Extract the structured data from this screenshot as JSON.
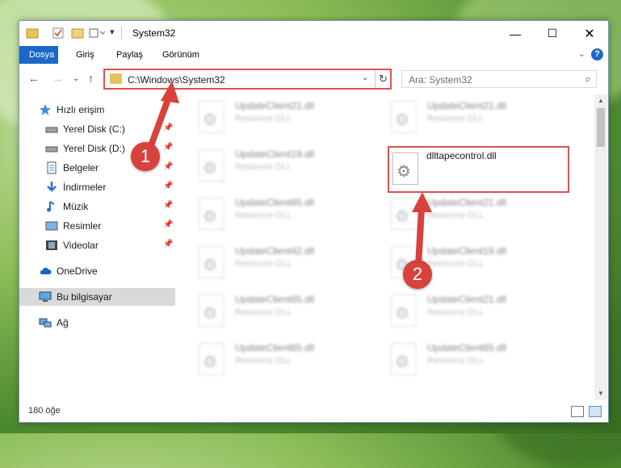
{
  "window": {
    "title": "System32"
  },
  "ribbon": {
    "tabs": [
      {
        "label": "Dosya",
        "active": true
      },
      {
        "label": "Giriş",
        "active": false
      },
      {
        "label": "Paylaş",
        "active": false
      },
      {
        "label": "Görünüm",
        "active": false
      }
    ],
    "help": "?"
  },
  "address": {
    "path": "C:\\Windows\\System32"
  },
  "search": {
    "placeholder": "Ara: System32"
  },
  "sidebar": {
    "items": [
      {
        "label": "Hızlı erişim",
        "icon": "star-icon"
      },
      {
        "label": "Yerel Disk (C:)",
        "icon": "drive-icon",
        "pinned": true
      },
      {
        "label": "Yerel Disk (D:)",
        "icon": "drive-icon",
        "pinned": true
      },
      {
        "label": "Belgeler",
        "icon": "documents-icon",
        "pinned": true
      },
      {
        "label": "İndirmeler",
        "icon": "download-icon",
        "pinned": true
      },
      {
        "label": "Müzik",
        "icon": "music-icon",
        "pinned": true
      },
      {
        "label": "Resimler",
        "icon": "pictures-icon",
        "pinned": true
      },
      {
        "label": "Videolar",
        "icon": "videos-icon",
        "pinned": true
      },
      {
        "label": "OneDrive",
        "icon": "cloud-icon"
      },
      {
        "label": "Bu bilgisayar",
        "icon": "computer-icon",
        "selected": true
      },
      {
        "label": "Ağ",
        "icon": "network-icon"
      }
    ]
  },
  "files": [
    {
      "name": "UpdateClient21.dll",
      "type": "Resource DLL"
    },
    {
      "name": "UpdateClient21.dll",
      "type": "Resource DLL"
    },
    {
      "name": "UpdateClient19.dll",
      "type": "Resource DLL"
    },
    {
      "name": "dlltapecontrol.dll",
      "type": ""
    },
    {
      "name": "UpdateClient65.dll",
      "type": "Resource DLL"
    },
    {
      "name": "UpdateClient21.dll",
      "type": "Resource DLL"
    },
    {
      "name": "UpdateClient42.dll",
      "type": "Resource DLL"
    },
    {
      "name": "UpdateClient19.dll",
      "type": "Resource DLL"
    },
    {
      "name": "UpdateClient65.dll",
      "type": "Resource DLL"
    },
    {
      "name": "UpdateClient21.dll",
      "type": "Resource DLL"
    },
    {
      "name": "UpdateClient65.dll",
      "type": "Resource DLL"
    },
    {
      "name": "UpdateClient65.dll",
      "type": "Resource DLL"
    }
  ],
  "status": {
    "count": "180 öğe"
  },
  "annotations": {
    "step1": "1",
    "step2": "2"
  },
  "colors": {
    "accent": "#1a67c8",
    "highlight": "#d9534f"
  }
}
